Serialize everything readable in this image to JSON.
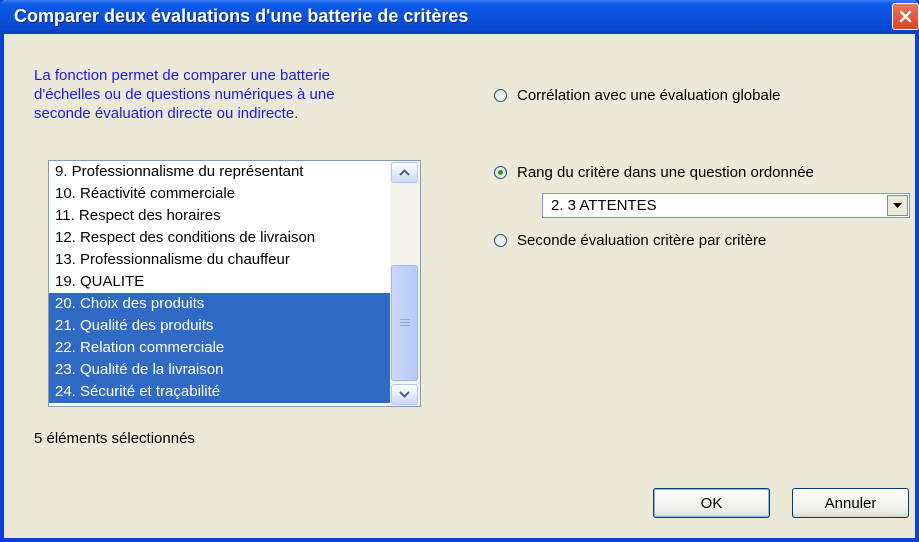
{
  "window": {
    "title": "Comparer deux évaluations d'une batterie de critères"
  },
  "description": "La fonction permet de comparer une batterie d'échelles ou de questions numériques à une seconde évaluation directe ou indirecte.",
  "list": {
    "items": [
      {
        "label": "9. Professionnalisme du représentant",
        "selected": false
      },
      {
        "label": "10. Réactivité commerciale",
        "selected": false
      },
      {
        "label": "11. Respect des horaires",
        "selected": false
      },
      {
        "label": "12. Respect des conditions de livraison",
        "selected": false
      },
      {
        "label": "13. Professionnalisme du chauffeur",
        "selected": false
      },
      {
        "label": "19. QUALITE",
        "selected": false
      },
      {
        "label": "20. Choix des produits",
        "selected": true
      },
      {
        "label": "21. Qualité des produits",
        "selected": true
      },
      {
        "label": "22. Relation commerciale",
        "selected": true
      },
      {
        "label": "23. Qualité de la livraison",
        "selected": true
      },
      {
        "label": "24. Sécurité et traçabilité",
        "selected": true
      }
    ]
  },
  "selection_count": "5 éléments sélectionnés",
  "options": {
    "correlation": {
      "label": "Corrélation avec une évaluation globale",
      "checked": false
    },
    "rank": {
      "label": "Rang du critère dans une question ordonnée",
      "checked": true
    },
    "second": {
      "label": "Seconde évaluation critère par critère",
      "checked": false
    }
  },
  "combo": {
    "value": "2. 3 ATTENTES"
  },
  "buttons": {
    "ok": "OK",
    "cancel": "Annuler"
  },
  "colors": {
    "title_bar": "#0a52dc",
    "selection": "#316ac5",
    "description_text": "#1c1ce0"
  }
}
